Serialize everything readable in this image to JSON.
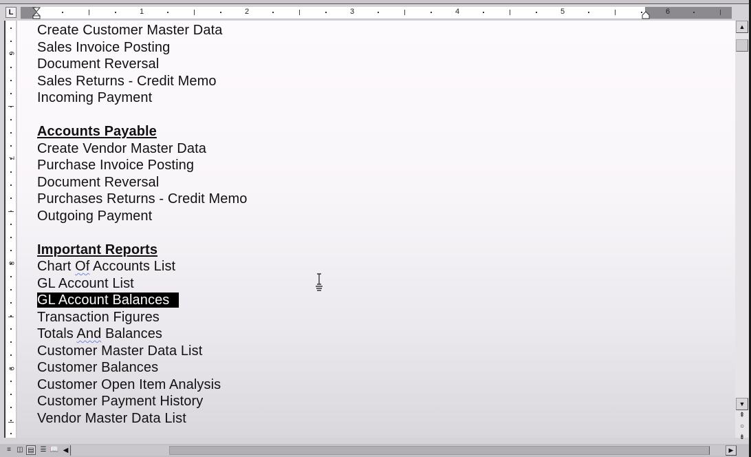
{
  "ruler": {
    "tab_stop_glyph": "L",
    "horizontal_numbers": [
      "1",
      "2",
      "3",
      "4",
      "5",
      "6"
    ],
    "vertical_numbers": [
      "6",
      "7",
      "8",
      "9"
    ]
  },
  "document": {
    "lines": [
      {
        "text": "Create Customer Master Data",
        "type": "item"
      },
      {
        "text": "Sales Invoice Posting",
        "type": "item"
      },
      {
        "text": "Document Reversal",
        "type": "item"
      },
      {
        "text": "Sales Returns - Credit Memo",
        "type": "item"
      },
      {
        "text": "Incoming Payment",
        "type": "item"
      },
      {
        "text": "",
        "type": "blank"
      },
      {
        "text": "Accounts Payable",
        "type": "heading"
      },
      {
        "text": "Create Vendor Master Data",
        "type": "item"
      },
      {
        "text": "Purchase Invoice Posting",
        "type": "item"
      },
      {
        "text": "Document Reversal",
        "type": "item"
      },
      {
        "text": "Purchases Returns - Credit Memo",
        "type": "item"
      },
      {
        "text": "Outgoing Payment",
        "type": "item"
      },
      {
        "text": "",
        "type": "blank"
      },
      {
        "text": "Important Reports",
        "type": "heading"
      },
      {
        "text": "Chart Of Accounts List",
        "type": "item",
        "squiggle": "Of"
      },
      {
        "text": "GL Account List",
        "type": "item"
      },
      {
        "text": "GL Account Balances",
        "type": "selected"
      },
      {
        "text": "Transaction Figures",
        "type": "item"
      },
      {
        "text": "Totals And Balances",
        "type": "item",
        "squiggle": "And"
      },
      {
        "text": "Customer Master Data List",
        "type": "item"
      },
      {
        "text": "Customer Balances",
        "type": "item"
      },
      {
        "text": "Customer Open Item Analysis",
        "type": "item"
      },
      {
        "text": "Customer Payment History",
        "type": "item"
      },
      {
        "text": "Vendor Master Data List",
        "type": "item"
      }
    ]
  },
  "scrollbar": {
    "up_glyph": "▲",
    "down_glyph": "▼",
    "prev_page_glyph": "⇞",
    "select_browse_glyph": "○",
    "next_page_glyph": "⇟",
    "left_glyph": "◀",
    "right_glyph": "▶"
  },
  "view_buttons": [
    {
      "name": "normal-view",
      "glyph": "≡",
      "active": false
    },
    {
      "name": "web-layout-view",
      "glyph": "◫",
      "active": false
    },
    {
      "name": "print-layout-view",
      "glyph": "▤",
      "active": true
    },
    {
      "name": "outline-view",
      "glyph": "☰",
      "active": false
    },
    {
      "name": "reading-layout-view",
      "glyph": "📖",
      "active": false
    }
  ]
}
